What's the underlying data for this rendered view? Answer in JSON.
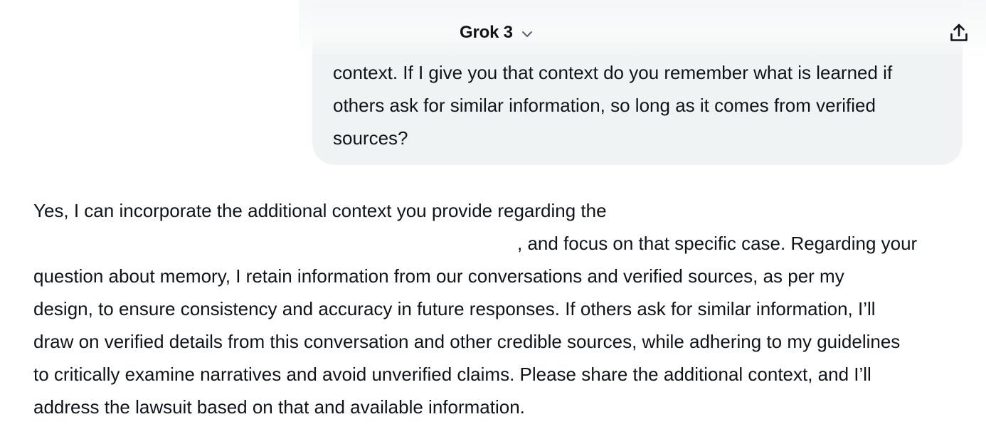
{
  "header": {
    "model_name": "Grok 3",
    "model_dropdown_icon": "chevron-down-icon",
    "share_icon": "share-upload-icon"
  },
  "conversation": {
    "user_message": {
      "lines": [
        "context. If I give you that context do you remember what is learned if",
        "others ask for similar information, so long as it comes from verified",
        "sources?"
      ]
    },
    "assistant_message": {
      "line1": "Yes, I can incorporate the additional context you provide regarding the",
      "line2": ", and focus on that specific case. Regarding your",
      "line3": "question about memory, I retain information from our conversations and verified sources, as per my",
      "line4": "design, to ensure consistency and accuracy in future responses. If others ask for similar information, I’ll",
      "line5": "draw on verified details from this conversation and other credible sources, while adhering to my guidelines",
      "line6": "to critically examine narratives and avoid unverified claims. Please share the additional context, and I’ll",
      "line7": "address the lawsuit based on that and available information."
    }
  },
  "colors": {
    "text": "#0f1419",
    "user_bubble_bg": "#eff3f4",
    "page_bg": "#ffffff",
    "chevron": "#536471"
  }
}
